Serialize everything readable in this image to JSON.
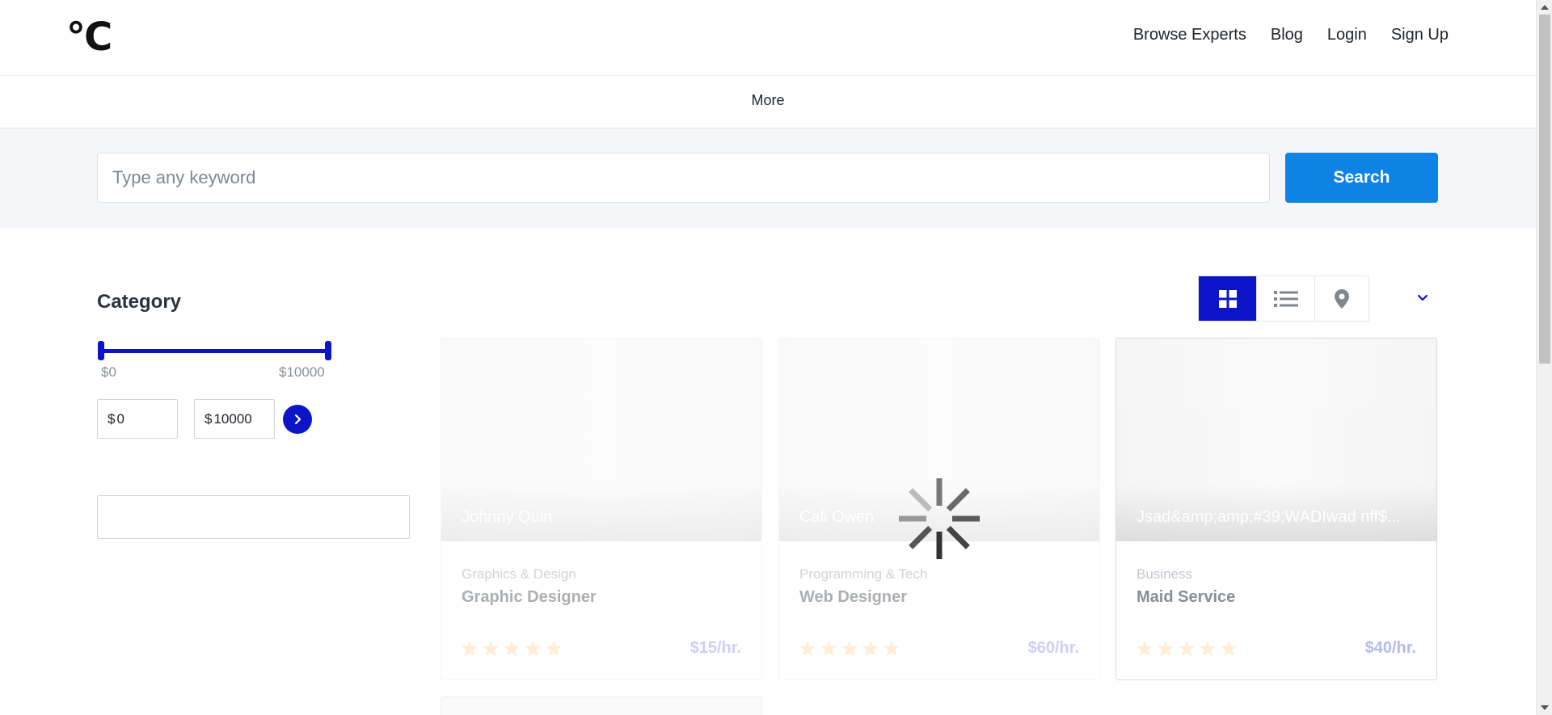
{
  "header": {
    "logo": "°C",
    "nav": [
      "Browse Experts",
      "Blog",
      "Login",
      "Sign Up"
    ]
  },
  "subnav": {
    "more_label": "More"
  },
  "search": {
    "placeholder": "Type any keyword",
    "value": "",
    "button_label": "Search"
  },
  "sidebar": {
    "category_title": "Category",
    "price_range": {
      "min_label": "$0",
      "max_label": "$10000",
      "currency": "$",
      "min_value": "0",
      "max_value": "10000"
    }
  },
  "view_toggle": {
    "options": [
      "grid-icon",
      "list-icon",
      "map-pin-icon"
    ],
    "active": "grid-icon"
  },
  "accent_color": "#0c14c9",
  "search_button_color": "#0f82e5",
  "star_color": "#ffd9a6",
  "cards": [
    {
      "name": "Johnny Quin",
      "category": "Graphics & Design",
      "role": "Graphic Designer",
      "rate": "$15/hr.",
      "stars": 5
    },
    {
      "name": "Cali Owen",
      "category": "Programming & Tech",
      "role": "Web Designer",
      "rate": "$60/hr.",
      "stars": 5
    },
    {
      "name": "Jsad&amp;amp;#39;WADIwad nff$...",
      "category": "Business",
      "role": "Maid Service",
      "rate": "$40/hr.",
      "stars": 5
    }
  ]
}
